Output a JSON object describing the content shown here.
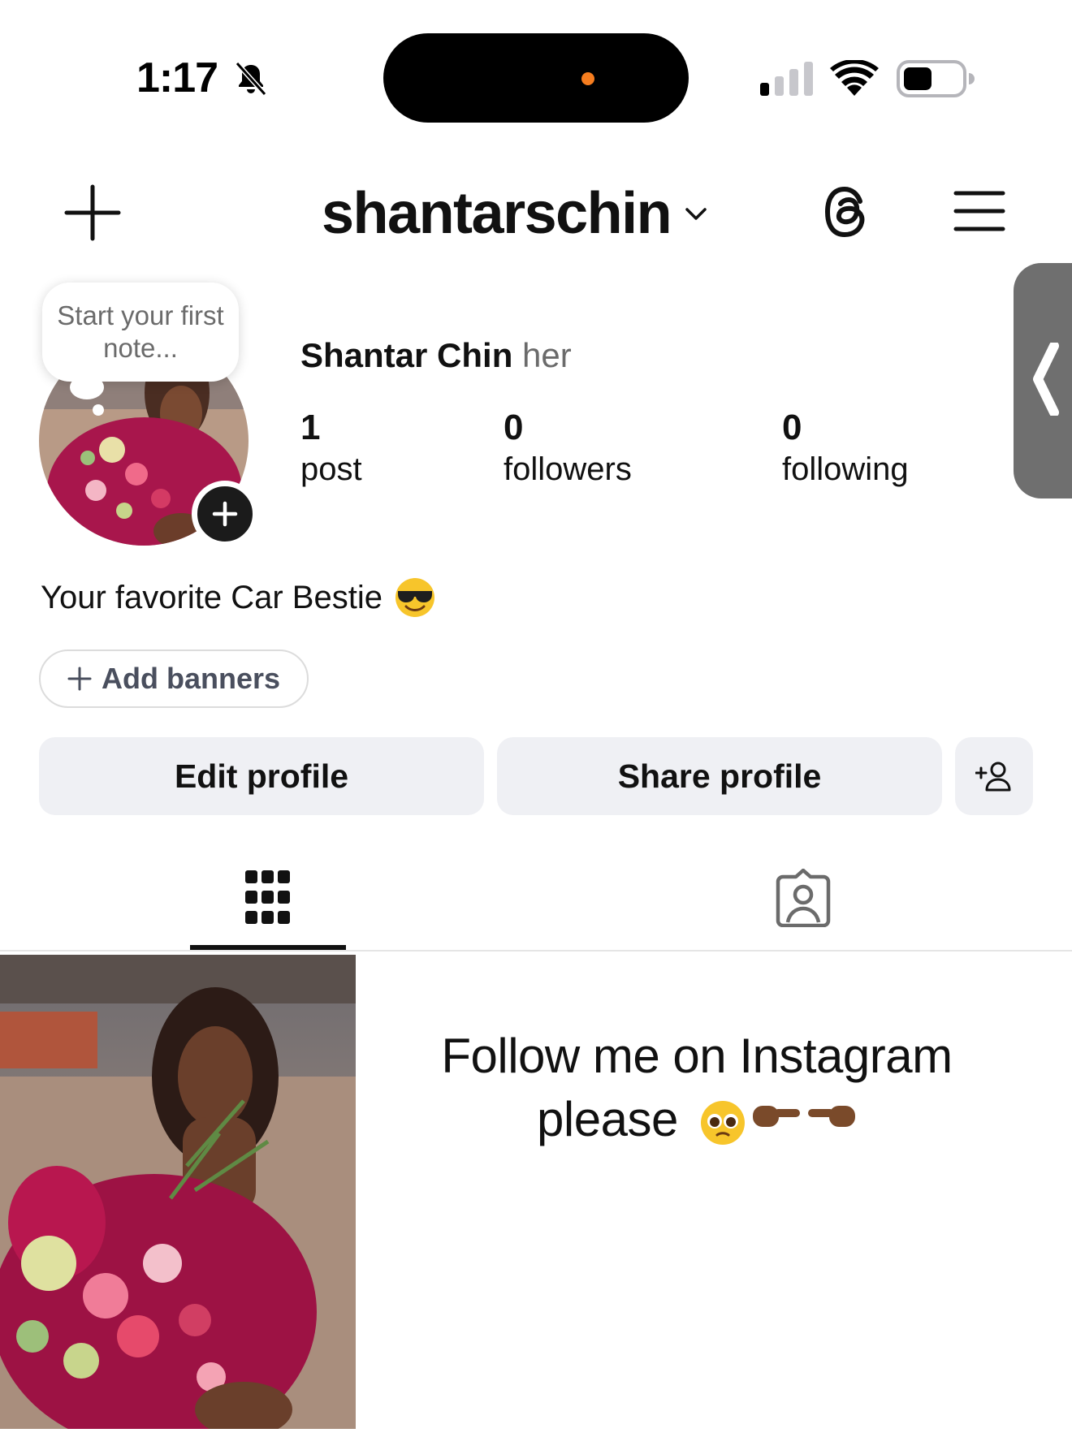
{
  "status_bar": {
    "time": "1:17",
    "silent_icon": "bell-slash-icon",
    "signal_icon": "cellular-signal-icon",
    "wifi_icon": "wifi-icon",
    "battery_icon": "battery-icon",
    "island_dot_color": "#f57d1f"
  },
  "header": {
    "create_icon": "plus-icon",
    "username": "shantarschin",
    "account_switch_icon": "chevron-down-icon",
    "threads_icon": "threads-icon",
    "menu_icon": "hamburger-menu-icon"
  },
  "note": {
    "placeholder": "Start your first note..."
  },
  "profile": {
    "full_name": "Shantar Chin",
    "pronouns": "her",
    "bio": "Your favorite Car Bestie",
    "bio_emoji": "smiling-face-with-sunglasses-emoji",
    "stats": {
      "posts": {
        "value": "1",
        "label": "post"
      },
      "followers": {
        "value": "0",
        "label": "followers"
      },
      "following": {
        "value": "0",
        "label": "following"
      }
    }
  },
  "actions": {
    "add_banners": "Add banners",
    "edit_profile": "Edit profile",
    "share_profile": "Share profile",
    "discover_people_icon": "add-person-icon"
  },
  "tabs": [
    {
      "icon": "grid-icon",
      "active": true
    },
    {
      "icon": "tagged-person-icon",
      "active": false
    }
  ],
  "overlay_text": {
    "line": "Follow me on Instagram please",
    "emojis": [
      "pleading-face-emoji",
      "backhand-index-pointing-right-emoji",
      "backhand-index-pointing-left-emoji"
    ]
  },
  "colors": {
    "background": "#ffffff",
    "button_bg": "#eff0f4",
    "text": "#111111",
    "muted_text": "#6b6b6b",
    "side_handle": "#6f6f6f"
  }
}
